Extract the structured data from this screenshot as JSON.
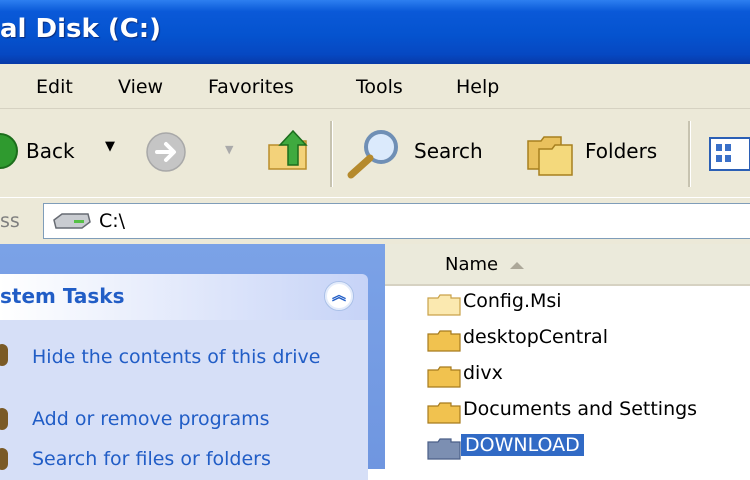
{
  "window": {
    "title": "al Disk (C:)"
  },
  "menu": {
    "items": [
      "Edit",
      "View",
      "Favorites",
      "Tools",
      "Help"
    ]
  },
  "toolbar": {
    "back_label": "Back",
    "search_label": "Search",
    "folders_label": "Folders"
  },
  "address": {
    "label": "ss",
    "value": "C:\\"
  },
  "tasks": {
    "header": "stem Tasks",
    "items": [
      "Hide the contents of this drive",
      "Add or remove programs",
      "Search for files or folders"
    ]
  },
  "filelist": {
    "column": "Name",
    "items": [
      {
        "name": "Config.Msi",
        "selected": false
      },
      {
        "name": "desktopCentral",
        "selected": false
      },
      {
        "name": "divx",
        "selected": false
      },
      {
        "name": "Documents and Settings",
        "selected": false
      },
      {
        "name": "DOWNLOAD",
        "selected": true
      }
    ]
  },
  "colors": {
    "titlebar": "#0553cf",
    "task_link": "#215dc6",
    "selection": "#316ac5",
    "chrome": "#ece9d8"
  }
}
